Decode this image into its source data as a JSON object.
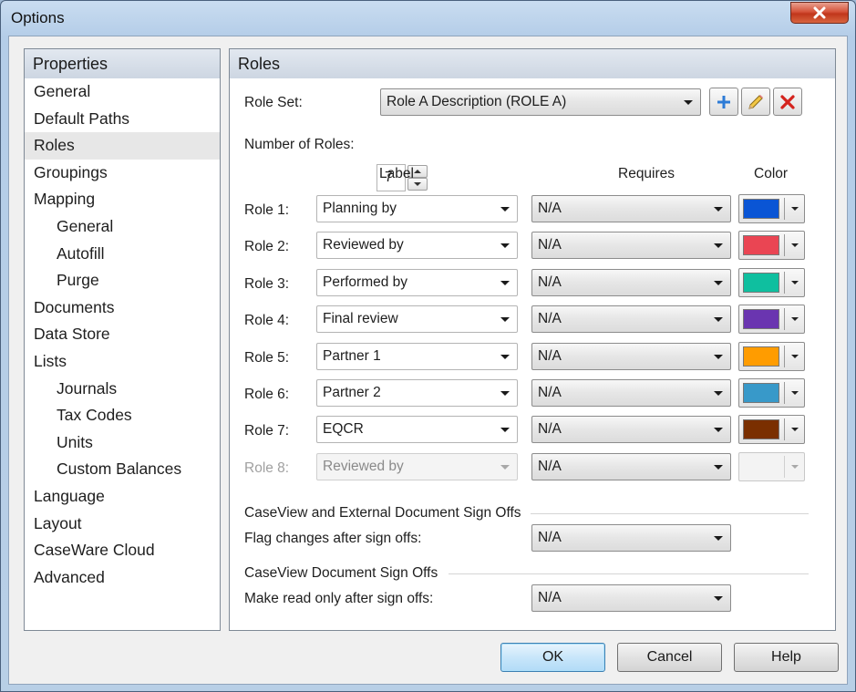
{
  "window": {
    "title": "Options"
  },
  "nav": {
    "header": "Properties",
    "items": [
      {
        "label": "General",
        "sub": false,
        "selected": false
      },
      {
        "label": "Default Paths",
        "sub": false,
        "selected": false
      },
      {
        "label": "Roles",
        "sub": false,
        "selected": true
      },
      {
        "label": "Groupings",
        "sub": false,
        "selected": false
      },
      {
        "label": "Mapping",
        "sub": false,
        "selected": false
      },
      {
        "label": "General",
        "sub": true,
        "selected": false
      },
      {
        "label": "Autofill",
        "sub": true,
        "selected": false
      },
      {
        "label": "Purge",
        "sub": true,
        "selected": false
      },
      {
        "label": "Documents",
        "sub": false,
        "selected": false
      },
      {
        "label": "Data Store",
        "sub": false,
        "selected": false
      },
      {
        "label": "Lists",
        "sub": false,
        "selected": false
      },
      {
        "label": "Journals",
        "sub": true,
        "selected": false
      },
      {
        "label": "Tax Codes",
        "sub": true,
        "selected": false
      },
      {
        "label": "Units",
        "sub": true,
        "selected": false
      },
      {
        "label": "Custom Balances",
        "sub": true,
        "selected": false
      },
      {
        "label": "Language",
        "sub": false,
        "selected": false
      },
      {
        "label": "Layout",
        "sub": false,
        "selected": false
      },
      {
        "label": "CaseWare Cloud",
        "sub": false,
        "selected": false
      },
      {
        "label": "Advanced",
        "sub": false,
        "selected": false
      }
    ]
  },
  "roles": {
    "header": "Roles",
    "role_set_label": "Role Set:",
    "role_set_value": "Role A Description (ROLE A)",
    "num_roles_label": "Number of Roles:",
    "num_roles_value": "7",
    "col_label": "Label",
    "col_requires": "Requires",
    "col_color": "Color",
    "rows": [
      {
        "name": "Role 1:",
        "label": "Planning by",
        "requires": "N/A",
        "color": "#0a55d5",
        "enabled": true
      },
      {
        "name": "Role 2:",
        "label": "Reviewed by",
        "requires": "N/A",
        "color": "#ea4553",
        "enabled": true
      },
      {
        "name": "Role 3:",
        "label": "Performed by",
        "requires": "N/A",
        "color": "#0fbf9f",
        "enabled": true
      },
      {
        "name": "Role 4:",
        "label": "Final review",
        "requires": "N/A",
        "color": "#6a35b0",
        "enabled": true
      },
      {
        "name": "Role 5:",
        "label": "Partner 1",
        "requires": "N/A",
        "color": "#ff9c00",
        "enabled": true
      },
      {
        "name": "Role 6:",
        "label": "Partner 2",
        "requires": "N/A",
        "color": "#3899c9",
        "enabled": true
      },
      {
        "name": "Role 7:",
        "label": "EQCR",
        "requires": "N/A",
        "color": "#7a2f00",
        "enabled": true
      },
      {
        "name": "Role 8:",
        "label": "Reviewed by",
        "requires": "N/A",
        "color": "",
        "enabled": false
      }
    ],
    "section1_title": "CaseView and External Document Sign Offs",
    "flag_label": "Flag changes after sign offs:",
    "flag_value": "N/A",
    "section2_title": "CaseView Document Sign Offs",
    "readonly_label": "Make read only after sign offs:",
    "readonly_value": "N/A"
  },
  "buttons": {
    "ok": "OK",
    "cancel": "Cancel",
    "help": "Help"
  },
  "icons": {
    "close": "close-icon",
    "add": "plus-icon",
    "edit": "pencil-icon",
    "delete": "x-delete-icon"
  }
}
